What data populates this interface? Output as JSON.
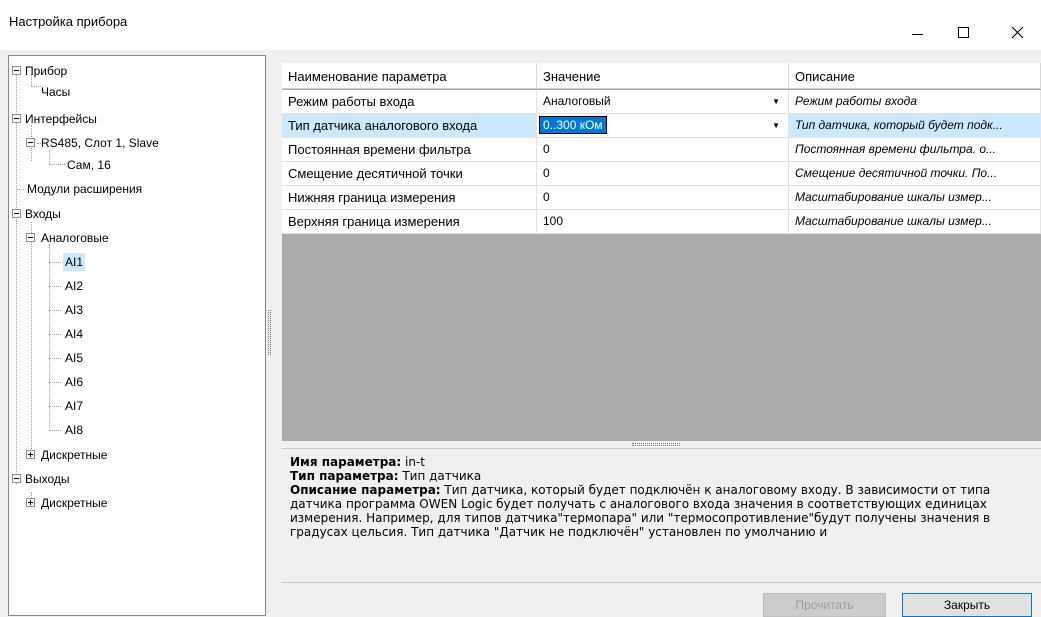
{
  "window": {
    "title": "Настройка прибора"
  },
  "tree": {
    "device": "Прибор",
    "clock": "Часы",
    "interfaces": "Интерфейсы",
    "rs485": "RS485, Слот 1, Slave",
    "sam": "Сам, 16",
    "modules": "Модули расширения",
    "inputs": "Входы",
    "analog": "Аналоговые",
    "ai": [
      "AI1",
      "AI2",
      "AI3",
      "AI4",
      "AI5",
      "AI6",
      "AI7",
      "AI8"
    ],
    "discrete_in": "Дискретные",
    "outputs": "Выходы",
    "discrete_out": "Дискретные"
  },
  "grid": {
    "headers": {
      "name": "Наименование параметра",
      "value": "Значение",
      "desc": "Описание"
    },
    "rows": [
      {
        "name": "Режим работы входа",
        "value": "Аналоговый",
        "desc": "Режим работы входа"
      },
      {
        "name": "Тип датчика аналогового входа",
        "value": "0..300 кОм",
        "desc": "Тип датчика, который будет подк..."
      },
      {
        "name": "Постоянная времени фильтра",
        "value": "0",
        "desc": "Постоянная времени фильтра. о..."
      },
      {
        "name": "Смещение десятичной точки",
        "value": "0",
        "desc": "Смещение десятичной точки. По..."
      },
      {
        "name": "Нижняя граница измерения",
        "value": "0",
        "desc": "Масштабирование шкалы измер..."
      },
      {
        "name": "Верхняя граница измерения",
        "value": "100",
        "desc": "Масштабирование шкалы измер..."
      }
    ]
  },
  "details": {
    "name_label": "Имя параметра:",
    "name_value": " in-t",
    "type_label": "Тип параметра:",
    "type_value": " Тип датчика",
    "desc_label": "Описание параметра:",
    "desc_value": " Тип датчика, который будет подключён к аналоговому входу. В зависимости от типа датчика программа OWEN Logic будет получать с аналогового входа значения в соответствующих единицах измерения. Например, для типов датчика\"термопара\" или \"термосопротивление\"будут получены значения в градусах цельсия. Тип датчика \"Датчик не подключён\" установлен по умолчанию и"
  },
  "buttons": {
    "read": "Прочитать",
    "close": "Закрыть"
  }
}
